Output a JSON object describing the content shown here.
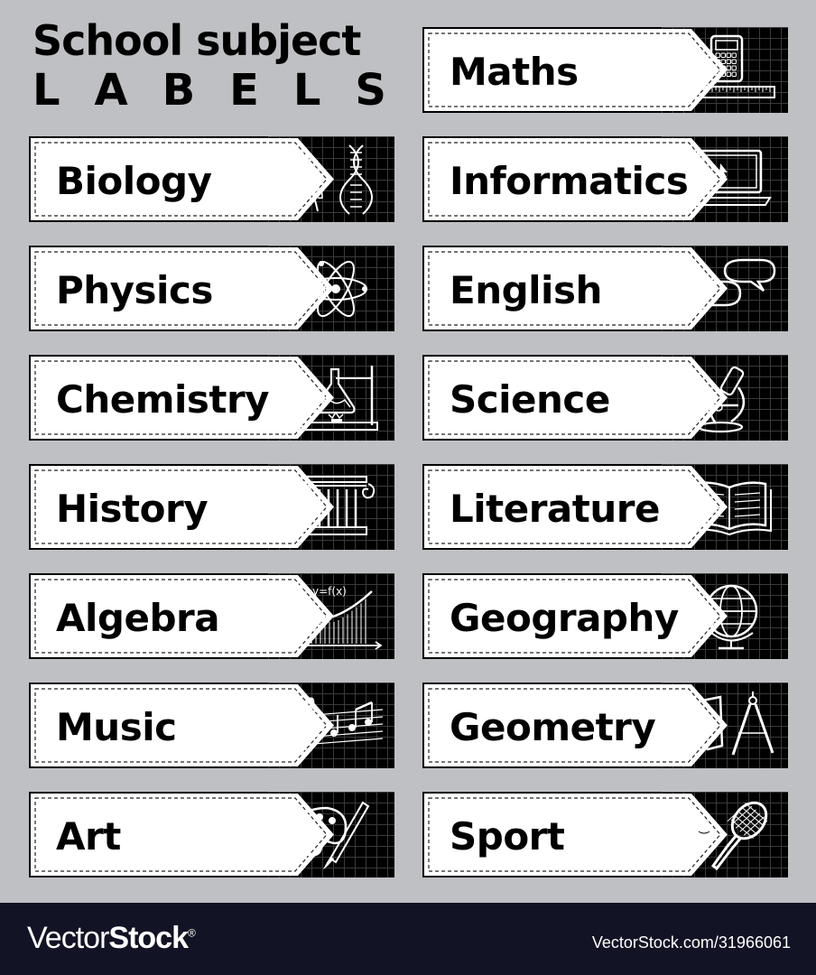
{
  "title": {
    "line1": "School subject",
    "line2": [
      "L",
      "A",
      "B",
      "E",
      "L",
      "S"
    ]
  },
  "labels": [
    {
      "name": "Maths",
      "icon": "calculator-ruler-icon"
    },
    {
      "name": "Biology",
      "icon": "flower-dna-icon"
    },
    {
      "name": "Informatics",
      "icon": "laptop-icon"
    },
    {
      "name": "Physics",
      "icon": "atom-icon"
    },
    {
      "name": "English",
      "icon": "speech-bubbles-icon"
    },
    {
      "name": "Chemistry",
      "icon": "flask-burner-icon"
    },
    {
      "name": "Science",
      "icon": "microscope-icon"
    },
    {
      "name": "History",
      "icon": "column-icon"
    },
    {
      "name": "Literature",
      "icon": "open-book-icon"
    },
    {
      "name": "Algebra",
      "icon": "function-graph-icon",
      "icon_text": "y=f(x)"
    },
    {
      "name": "Geography",
      "icon": "globe-icon"
    },
    {
      "name": "Music",
      "icon": "music-notes-icon"
    },
    {
      "name": "Geometry",
      "icon": "protractor-compass-icon"
    },
    {
      "name": "Art",
      "icon": "palette-brush-icon"
    },
    {
      "name": "Sport",
      "icon": "tennis-racket-icon"
    }
  ],
  "footer": {
    "brand_light": "Vector",
    "brand_bold": "Stock",
    "reg": "®",
    "url": "VectorStock.com/31966061"
  },
  "colors": {
    "background": "#bfc0c4",
    "label_dark": "#000000",
    "footer": "#121324"
  }
}
